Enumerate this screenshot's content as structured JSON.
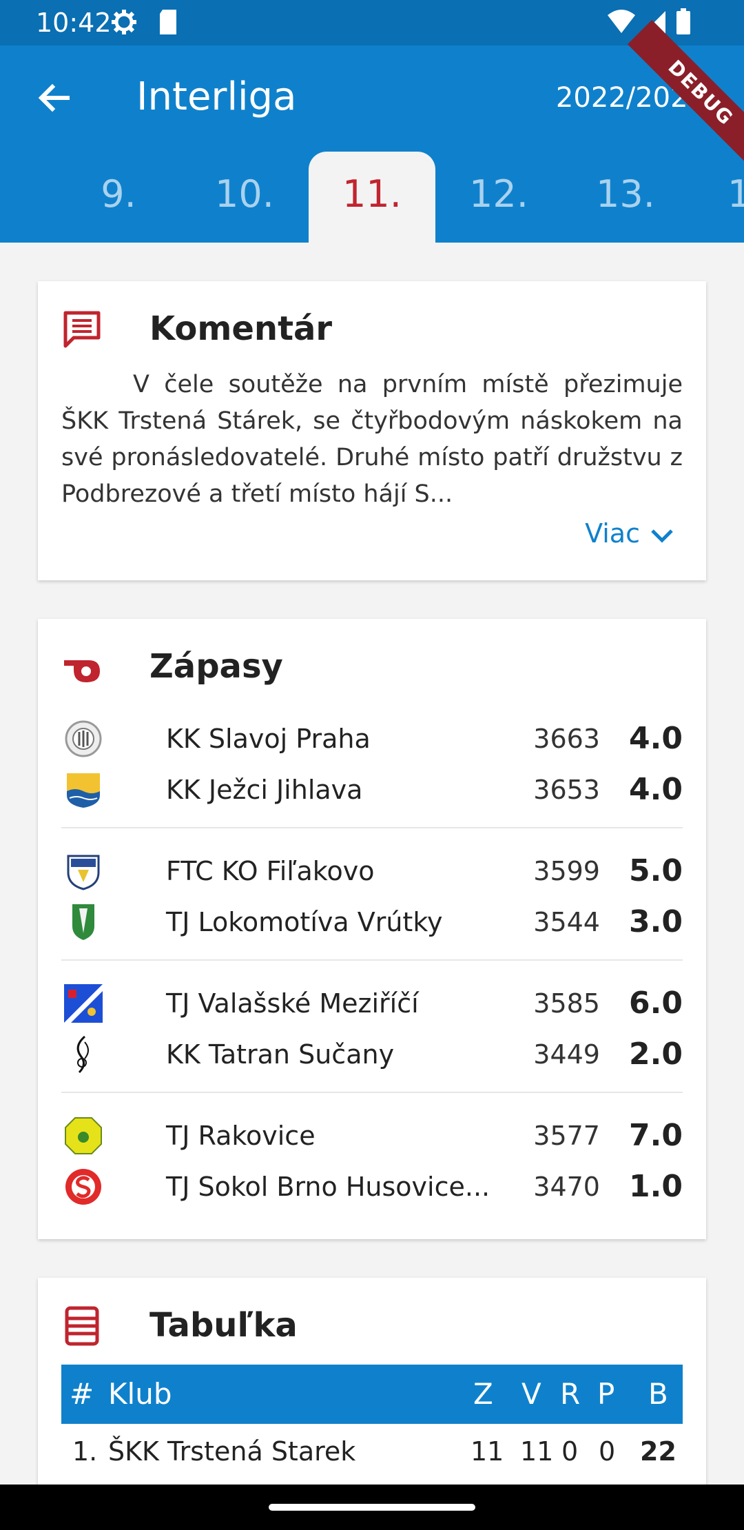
{
  "status_bar": {
    "time": "10:42"
  },
  "app_bar": {
    "title": "Interliga",
    "season": "2022/2023",
    "debug_banner": "DEBUG"
  },
  "rounds": {
    "tabs": [
      ".",
      "9.",
      "10.",
      "11.",
      "12.",
      "13.",
      "1"
    ],
    "selected": "11."
  },
  "comment": {
    "title": "Komentár",
    "text": "V čele soutěže na prvním místě přezimuje ŠKK Trstená Stárek, se čtyřbodovým náskokem na své pronásledovatelé. Druhé místo patří družstvu z Podbrezové a třetí místo hájí S...",
    "more_label": "Viac"
  },
  "matches": {
    "title": "Zápasy",
    "items": [
      {
        "home": {
          "name": "KK Slavoj Praha",
          "score": "3663",
          "points": "4.0"
        },
        "away": {
          "name": "KK Ježci Jihlava",
          "score": "3653",
          "points": "4.0"
        }
      },
      {
        "home": {
          "name": "FTC KO Fiľakovo",
          "score": "3599",
          "points": "5.0"
        },
        "away": {
          "name": "TJ Lokomotíva Vrútky",
          "score": "3544",
          "points": "3.0"
        }
      },
      {
        "home": {
          "name": "TJ Valašské Meziříčí",
          "score": "3585",
          "points": "6.0"
        },
        "away": {
          "name": "KK Tatran Sučany",
          "score": "3449",
          "points": "2.0"
        }
      },
      {
        "home": {
          "name": "TJ Rakovice",
          "score": "3577",
          "points": "7.0"
        },
        "away": {
          "name": "TJ Sokol Brno Husovice...",
          "score": "3470",
          "points": "1.0"
        }
      }
    ]
  },
  "table": {
    "title": "Tabuľka",
    "headers": {
      "rank": "#",
      "club": "Klub",
      "played": "Z",
      "won": "V",
      "draw": "R",
      "lost": "P",
      "points": "B"
    },
    "rows": [
      {
        "rank": "1.",
        "club": "ŠKK Trstená Starek",
        "played": "11",
        "won": "11",
        "draw": "0",
        "lost": "0",
        "points": "22"
      }
    ]
  },
  "colors": {
    "primary": "#0f81cc",
    "status_bar": "#0a6fb3",
    "accent_red": "#c0242e"
  }
}
